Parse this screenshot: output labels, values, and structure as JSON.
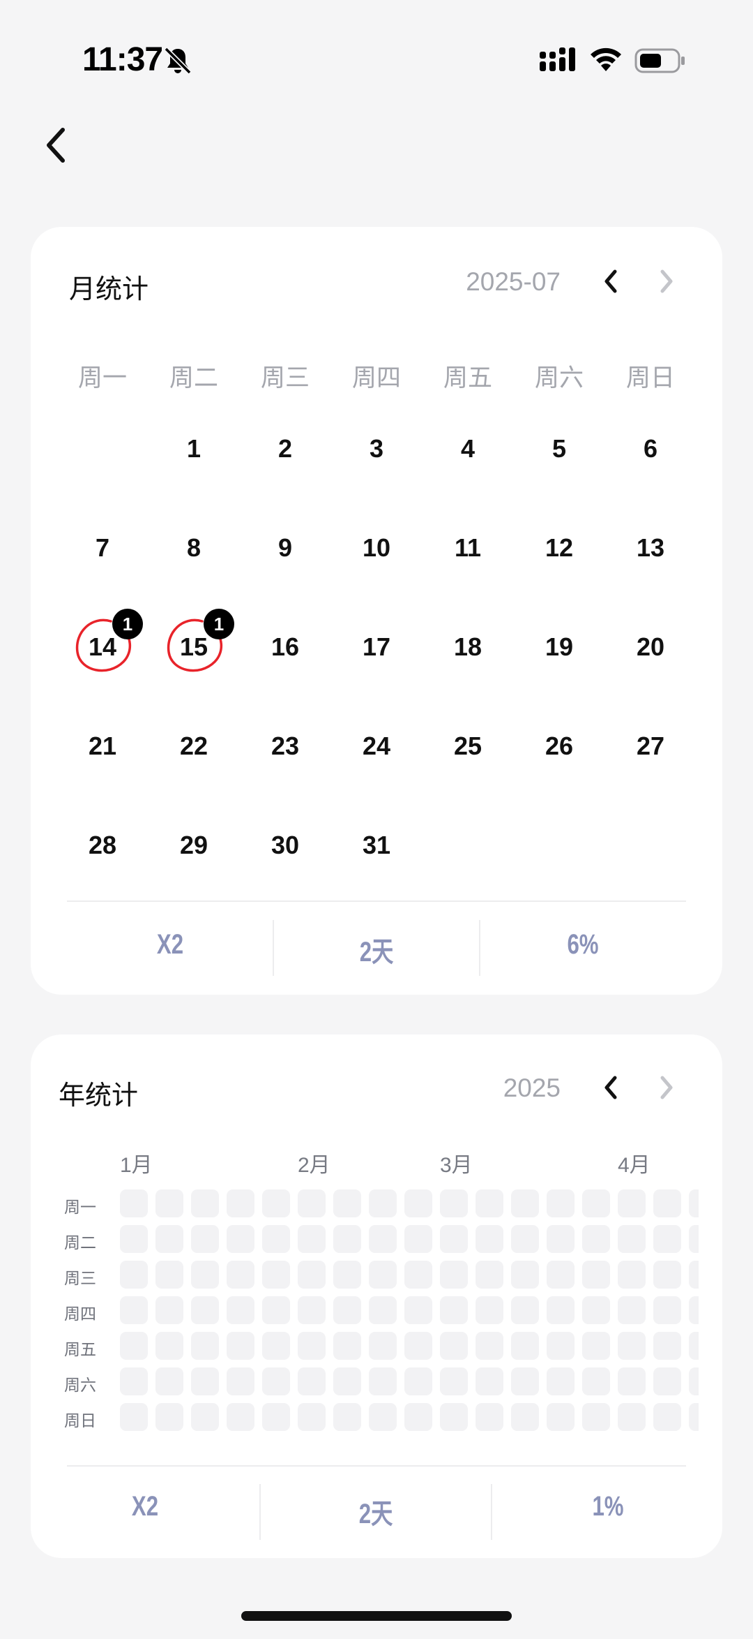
{
  "status_bar": {
    "time": "11:37",
    "icons": [
      "bell-slash-icon",
      "cellular-signal-icon",
      "wifi-icon",
      "battery-icon"
    ]
  },
  "nav": {
    "back_icon": "chevron-left-icon"
  },
  "month_stats": {
    "title": "月统计",
    "period": "2025-07",
    "weekdays": [
      "周一",
      "周二",
      "周三",
      "周四",
      "周五",
      "周六",
      "周日"
    ],
    "first_weekday_index": 1,
    "days_in_month": 31,
    "marked_days": [
      {
        "day": 14,
        "count": "1"
      },
      {
        "day": 15,
        "count": "1"
      }
    ],
    "ring_color": "#e8232a",
    "stats": [
      "X2",
      "2天",
      "6%"
    ]
  },
  "year_stats": {
    "title": "年统计",
    "period": "2025",
    "row_labels": [
      "周一",
      "周二",
      "周三",
      "周四",
      "周五",
      "周六",
      "周日"
    ],
    "months": [
      {
        "label": "1月",
        "week": 0
      },
      {
        "label": "2月",
        "week": 5
      },
      {
        "label": "3月",
        "week": 9
      },
      {
        "label": "4月",
        "week": 14
      }
    ],
    "stats": [
      "X2",
      "2天",
      "1%"
    ]
  },
  "colors": {
    "accent_stat": "#8a92b8",
    "heat_empty": "#f2f2f4",
    "muted_text": "#a4a6ad"
  }
}
